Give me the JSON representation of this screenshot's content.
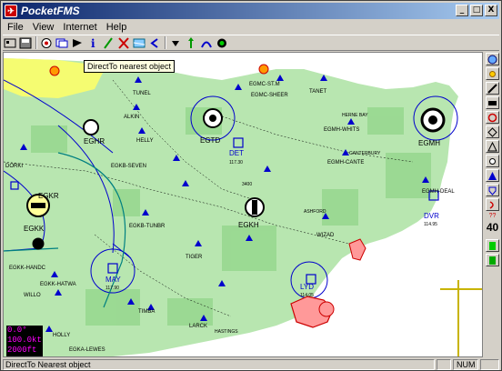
{
  "window": {
    "title": "PocketFMS",
    "icon": "app-icon",
    "controls": [
      "_",
      "□",
      "X"
    ]
  },
  "menu": [
    "File",
    "View",
    "Internet",
    "Help"
  ],
  "toolbar": {
    "tooltip": "DirectTo nearest object"
  },
  "sidebar": {
    "scale_label": "??",
    "zoom_value": "40"
  },
  "info": {
    "heading": "0.0°",
    "speed": "100.0kt",
    "altitude": "2000ft"
  },
  "status": {
    "text": "DirectTo Nearest object",
    "num": "NUM"
  },
  "map": {
    "colors": {
      "land": "#b8e6b0",
      "sea": "#ffffff",
      "airspace": "#0000cc",
      "danger": "#cc0000"
    },
    "labels": {
      "egmc_st_m": "EGMC-ST.M",
      "egmc_sheer": "EGMC-SHEER",
      "tanet": "TANET",
      "egtd": "EGTD",
      "det": "DET",
      "det_freq": "117.30",
      "tunel": "TUNEL",
      "alkin": "ALKIN",
      "helly": "HELLY",
      "egkb_seven": "EGKB-SEVEN",
      "eghr": "EGHR",
      "dorki": "DORKI",
      "egkr": "EGKR",
      "egkk": "EGKK",
      "egkb_tunbr": "EGKB-TUNBR",
      "egkh": "EGKH",
      "egkh_alt": "3400",
      "egmh_whits": "EGMH-WHITS",
      "egmh_cante": "EGMH-CANTE",
      "egmh": "EGMH",
      "egmh_deal": "EGMH-DEAL",
      "dvr": "DVR",
      "dvr_freq": "114.95",
      "wizad": "WIZAD",
      "tiger": "TIGER",
      "may": "MAY",
      "may_freq": "117.90",
      "egkk_hatwa": "EGKK-HATWA",
      "egkk_handc": "EGKK-HANDC",
      "willo": "WILLO",
      "timba": "TIMBA",
      "larck": "LARCK",
      "lyd": "LYD",
      "lyd_freq": "114.05",
      "egka_lewes": "EGKA-LEWES",
      "holly": "HOLLY",
      "hastings": "HASTINGS",
      "canterbury": "CANTERBURY",
      "ashford": "ASHFORD",
      "herne_bay": "HERNE BAY"
    }
  }
}
